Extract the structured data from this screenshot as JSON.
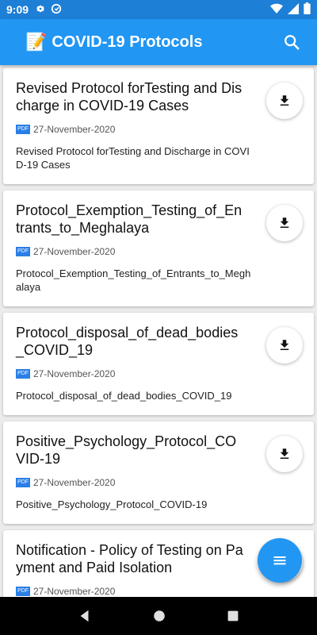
{
  "status_bar": {
    "time": "9:09",
    "icons": [
      "gear-icon",
      "sync-icon",
      "wifi-icon",
      "signal-icon",
      "battery-icon"
    ]
  },
  "app_bar": {
    "emoji": "📝",
    "title": "COVID-19 Protocols",
    "search_icon": "search-icon"
  },
  "colors": {
    "primary": "#2196f3",
    "status_bar": "#1e7fd6",
    "pdf_badge": "#2a7ee6"
  },
  "cards": [
    {
      "title": "Revised Protocol forTesting and Discharge in COVID-19 Cases",
      "badge": "PDF",
      "date": "27-November-2020",
      "description": "Revised Protocol forTesting and Discharge in COVID-19 Cases"
    },
    {
      "title": "Protocol_Exemption_Testing_of_Entrants_to_Meghalaya",
      "badge": "PDF",
      "date": "27-November-2020",
      "description": "Protocol_Exemption_Testing_of_Entrants_to_Meghalaya"
    },
    {
      "title": "Protocol_disposal_of_dead_bodies_COVID_19",
      "badge": "PDF",
      "date": "27-November-2020",
      "description": "Protocol_disposal_of_dead_bodies_COVID_19"
    },
    {
      "title": "Positive_Psychology_Protocol_COVID-19",
      "badge": "PDF",
      "date": "27-November-2020",
      "description": "Positive_Psychology_Protocol_COVID-19"
    },
    {
      "title": "Notification - Policy of Testing on Payment and Paid Isolation",
      "badge": "PDF",
      "date": "27-November-2020",
      "description": ""
    }
  ],
  "fab": {
    "icon": "menu-icon"
  },
  "nav_bar": {
    "icons": [
      "back-icon",
      "home-icon",
      "recents-icon"
    ]
  }
}
